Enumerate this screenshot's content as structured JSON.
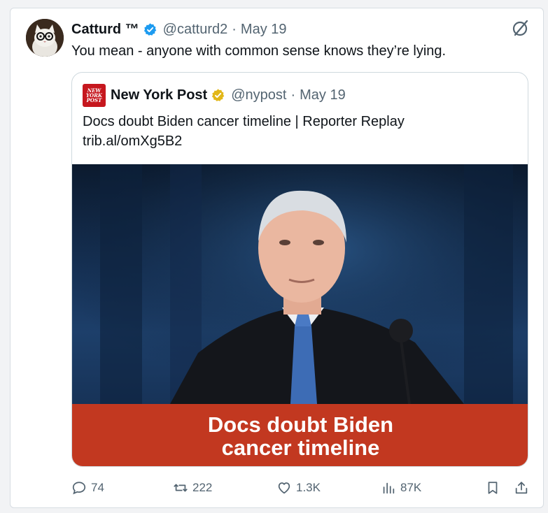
{
  "tweet": {
    "author_name": "Catturd ™",
    "handle": "@catturd2",
    "separator": "·",
    "date": "May 19",
    "text": "You mean - anyone with common sense knows they’re lying."
  },
  "quoted": {
    "logo_lines": [
      "NEW",
      "YORK",
      "POST"
    ],
    "author_name": "New York Post",
    "handle": "@nypost",
    "separator": "·",
    "date": "May 19",
    "text_line1": "Docs doubt Biden cancer timeline | Reporter Replay",
    "text_line2": "trib.al/omXg5B2",
    "banner_line1": "Docs doubt Biden",
    "banner_line2": "cancer timeline"
  },
  "actions": {
    "replies": "74",
    "reposts": "222",
    "likes": "1.3K",
    "views": "87K"
  },
  "icons": {
    "verified_blue": "verified-badge-icon",
    "verified_gold": "gold-verified-badge-icon",
    "grok": "grok-icon",
    "reply": "reply-icon",
    "repost": "repost-icon",
    "like": "heart-icon",
    "views": "views-icon",
    "bookmark": "bookmark-icon",
    "share": "share-icon"
  },
  "colors": {
    "verified_blue": "#1d9bf0",
    "verified_gold": "#e2b719",
    "nypost_red": "#c6171e",
    "banner_red": "#c23820",
    "muted_text": "#536471"
  }
}
